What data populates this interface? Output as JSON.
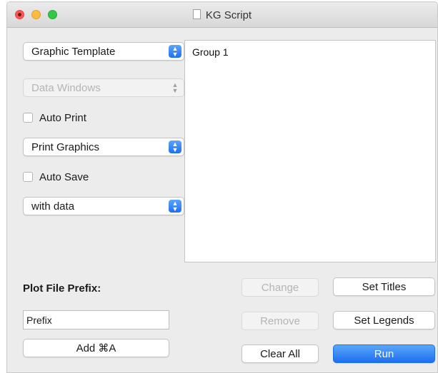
{
  "window": {
    "title": "KG Script"
  },
  "left_panel": {
    "template_popup": {
      "value": "Graphic Template"
    },
    "data_windows_popup": {
      "value": "Data Windows"
    },
    "auto_print": {
      "label": "Auto Print",
      "checked": false
    },
    "print_popup": {
      "value": "Print Graphics"
    },
    "auto_save": {
      "label": "Auto Save",
      "checked": false
    },
    "save_popup": {
      "value": "with data"
    },
    "prefix_label": "Plot File Prefix:",
    "prefix_field": {
      "value": "Prefix"
    },
    "add_button": "Add ⌘A"
  },
  "list": {
    "items": [
      "Group 1"
    ]
  },
  "buttons": {
    "change": "Change",
    "remove": "Remove",
    "clear_all": "Clear All",
    "set_titles": "Set Titles",
    "set_legends": "Set Legends",
    "run": "Run"
  },
  "icons": {
    "stepper": "up-down-chevron-icon",
    "document": "document-icon"
  },
  "colors": {
    "accent": "#1d6ff0",
    "close": "#fc5753",
    "minimize": "#fdbc40",
    "zoom": "#33c748"
  }
}
